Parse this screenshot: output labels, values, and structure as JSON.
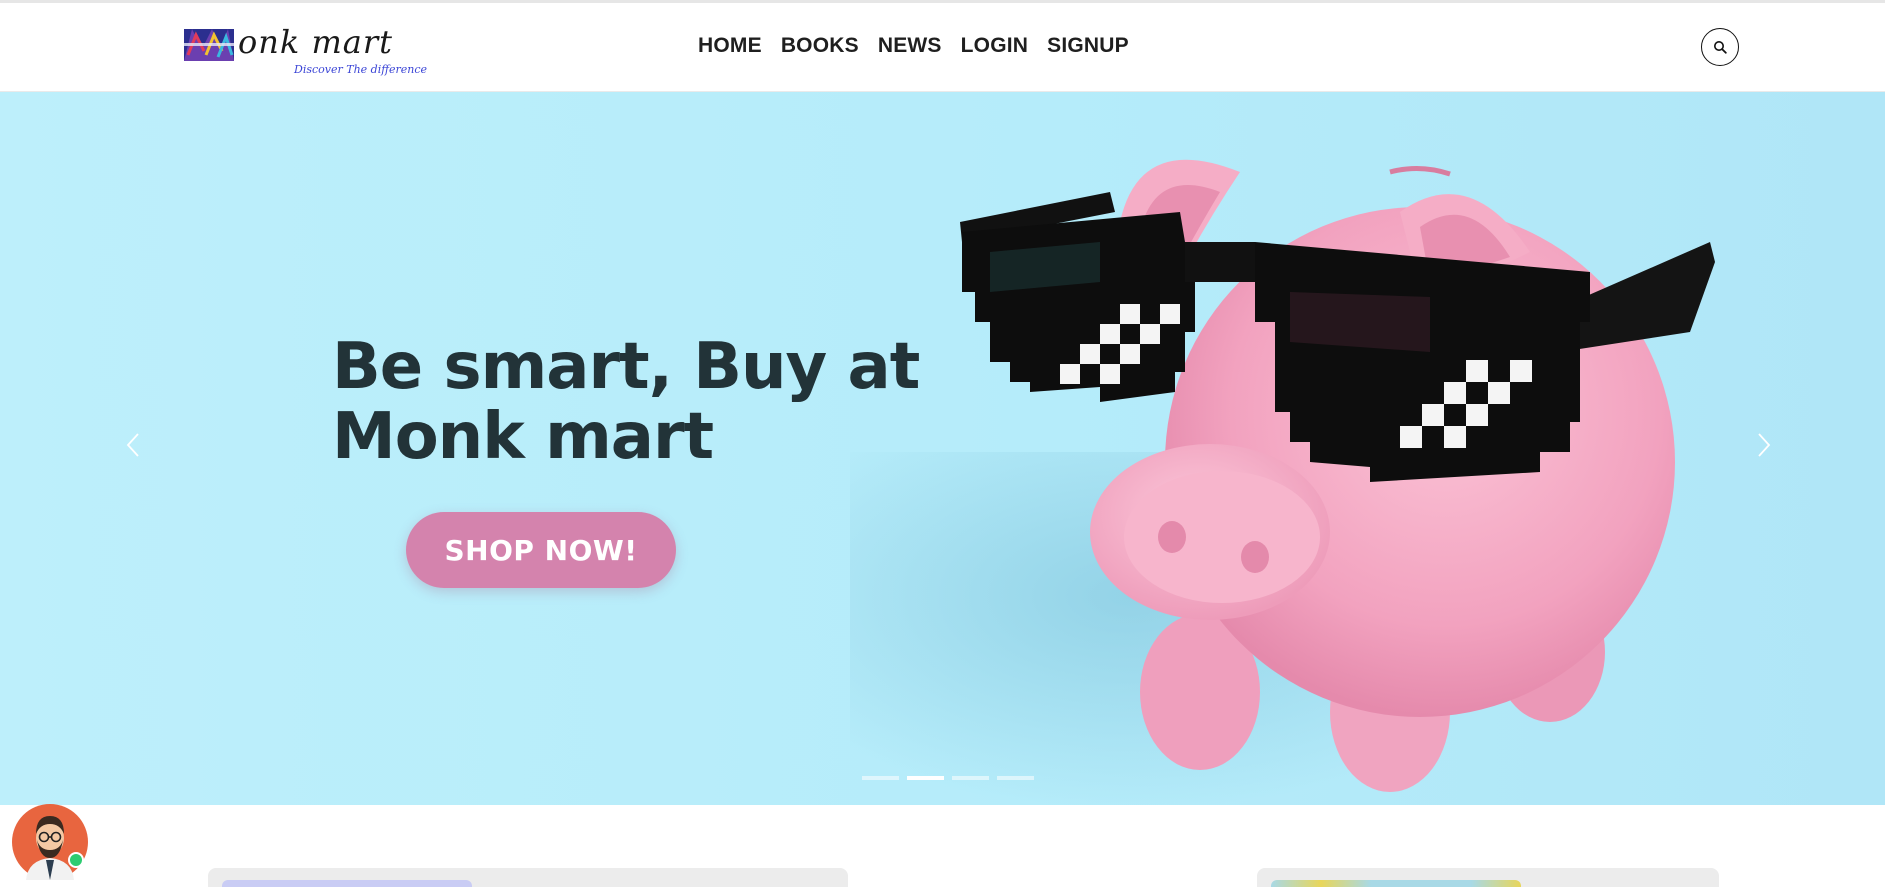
{
  "header": {
    "logo": {
      "text": "onk mart",
      "tagline": "Discover The difference"
    },
    "nav": [
      {
        "label": "HOME"
      },
      {
        "label": "BOOKS"
      },
      {
        "label": "NEWS"
      },
      {
        "label": "LOGIN"
      },
      {
        "label": "SIGNUP"
      }
    ],
    "search_icon": "search-icon"
  },
  "hero": {
    "headline_line1": "Be smart, Buy at",
    "headline_line2": "Monk mart",
    "cta_label": "SHOP NOW!",
    "slide_count": 4,
    "active_slide": 2,
    "prev_icon": "chevron-left-icon",
    "next_icon": "chevron-right-icon",
    "image": "piggy-bank-with-pixel-sunglasses"
  },
  "colors": {
    "hero_bg": "#b5ecfa",
    "cta_bg": "#d483ad",
    "headline": "#223338",
    "logo_tagline": "#3b45d6",
    "online_status": "#2ecc71"
  },
  "chat_widget": {
    "avatar_icon": "support-agent-avatar-icon",
    "status": "online"
  }
}
